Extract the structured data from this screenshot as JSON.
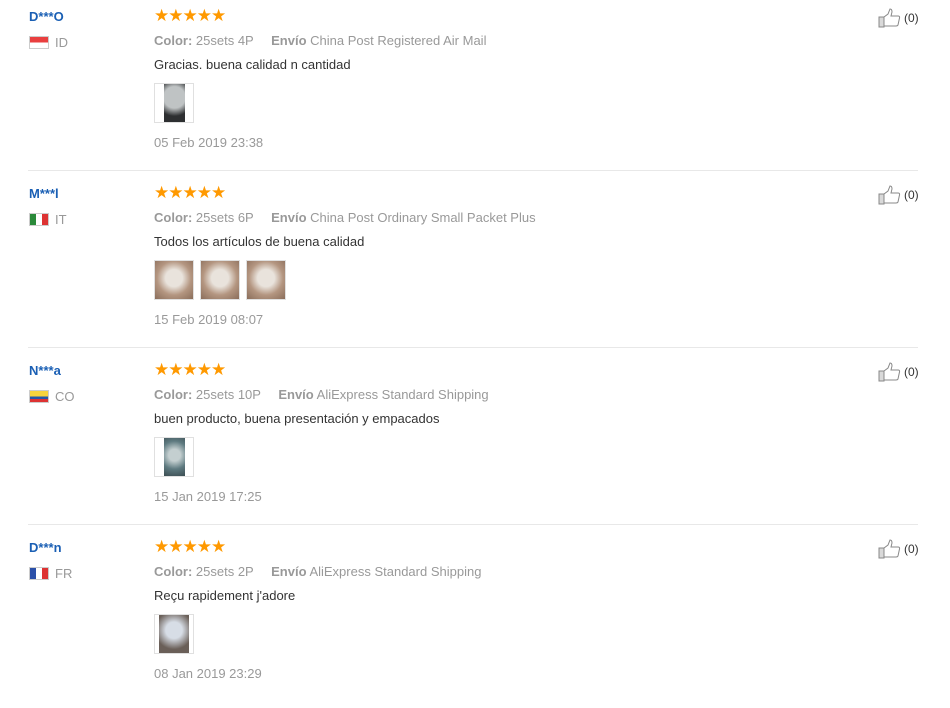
{
  "colors": {
    "user": "#1a5fb4",
    "stars": "#ff9900",
    "meta": "#999999",
    "text": "#333333"
  },
  "labels": {
    "color": "Color:",
    "shipping": "Envío"
  },
  "reviews": [
    {
      "user": "D***O",
      "country": "ID",
      "stars": "★★★★★",
      "color_value": "25sets 4P",
      "shipping_value": "China Post Registered Air Mail",
      "text": "Gracias. buena calidad n cantidad",
      "photos": 1,
      "date": "05 Feb 2019 23:38",
      "helpful": "(0)"
    },
    {
      "user": "M***l",
      "country": "IT",
      "stars": "★★★★★",
      "color_value": "25sets 6P",
      "shipping_value": "China Post Ordinary Small Packet Plus",
      "text": "Todos los artículos de buena calidad",
      "photos": 3,
      "date": "15 Feb 2019 08:07",
      "helpful": "(0)"
    },
    {
      "user": "N***a",
      "country": "CO",
      "stars": "★★★★★",
      "color_value": "25sets 10P",
      "shipping_value": "AliExpress Standard Shipping",
      "text": "buen producto, buena presentación y empacados",
      "photos": 1,
      "date": "15 Jan 2019 17:25",
      "helpful": "(0)"
    },
    {
      "user": "D***n",
      "country": "FR",
      "stars": "★★★★★",
      "color_value": "25sets 2P",
      "shipping_value": "AliExpress Standard Shipping",
      "text": "Reçu rapidement j'adore",
      "photos": 1,
      "date": "08 Jan 2019 23:29",
      "helpful": "(0)"
    }
  ]
}
